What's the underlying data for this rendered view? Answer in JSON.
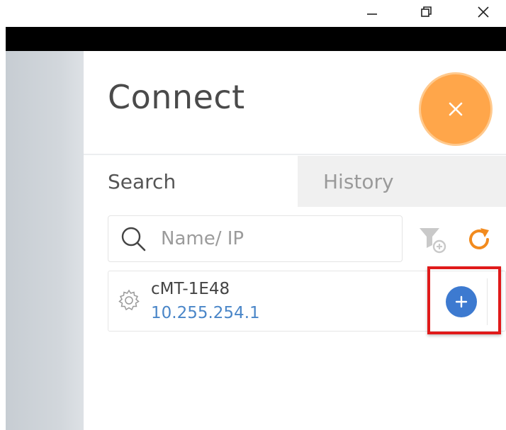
{
  "window_controls": {
    "minimize": "minimize-icon",
    "restore": "restore-icon",
    "close": "close-icon"
  },
  "panel": {
    "title": "Connect",
    "close_button_icon": "close-icon"
  },
  "tabs": [
    {
      "label": "Search",
      "active": true
    },
    {
      "label": "History",
      "active": false
    }
  ],
  "search": {
    "placeholder": "Name/ IP",
    "value": ""
  },
  "toolbar": {
    "filter_icon": "filter-add-icon",
    "refresh_icon": "refresh-icon"
  },
  "devices": [
    {
      "name": "cMT-1E48",
      "ip": "10.255.254.1",
      "icon": "gear-icon",
      "action_icon": "plus-icon"
    }
  ],
  "colors": {
    "accent_orange": "#ffa64a",
    "add_blue": "#3d7ad0",
    "ip_blue": "#4a86c8",
    "highlight_red": "#e01a1a"
  }
}
